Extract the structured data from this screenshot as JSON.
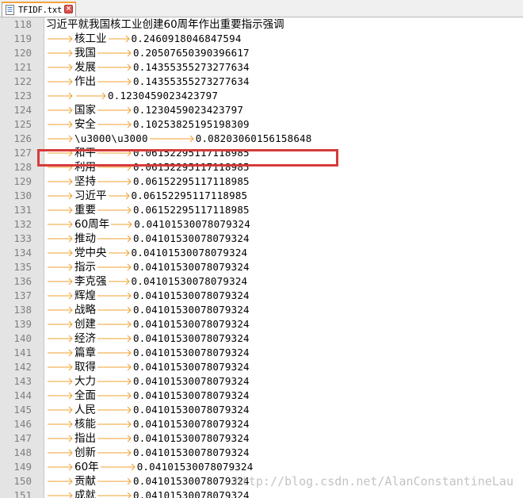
{
  "tab": {
    "label": "TFIDF.txt",
    "close_icon": "close-icon",
    "file_icon": "text-file-icon"
  },
  "colors": {
    "arrow": "#f0a030",
    "highlight": "#d63b3b",
    "gutter": "#e4e4e4"
  },
  "lines": [
    {
      "n": "118",
      "text": "习近平就我国核工业创建60周年作出重要指示强调",
      "value": "",
      "header": true
    },
    {
      "n": "119",
      "text": "核工业",
      "value": "0.2460918046847594"
    },
    {
      "n": "120",
      "text": "我国",
      "value": "0.20507650390396617"
    },
    {
      "n": "121",
      "text": "发展",
      "value": "0.14355355273277634"
    },
    {
      "n": "122",
      "text": "作出",
      "value": "0.14355355273277634"
    },
    {
      "n": "123",
      "text": "",
      "value": "0.1230459023423797",
      "emptyword": true
    },
    {
      "n": "124",
      "text": "国家",
      "value": "0.1230459023423797"
    },
    {
      "n": "125",
      "text": "安全",
      "value": "0.10253825195198309"
    },
    {
      "n": "126",
      "text": "\\u3000\\u3000",
      "value": "0.08203060156158648",
      "ascii": true
    },
    {
      "n": "127",
      "text": "和平",
      "value": "0.06152295117118985"
    },
    {
      "n": "128",
      "text": "利用",
      "value": "0.06152295117118985"
    },
    {
      "n": "129",
      "text": "坚持",
      "value": "0.06152295117118985"
    },
    {
      "n": "130",
      "text": "习近平",
      "value": "0.06152295117118985"
    },
    {
      "n": "131",
      "text": "重要",
      "value": "0.06152295117118985"
    },
    {
      "n": "132",
      "text": "60周年",
      "value": "0.04101530078079324"
    },
    {
      "n": "133",
      "text": "推动",
      "value": "0.04101530078079324"
    },
    {
      "n": "134",
      "text": "党中央",
      "value": "0.04101530078079324"
    },
    {
      "n": "135",
      "text": "指示",
      "value": "0.04101530078079324"
    },
    {
      "n": "136",
      "text": "李克强",
      "value": "0.04101530078079324"
    },
    {
      "n": "137",
      "text": "辉煌",
      "value": "0.04101530078079324"
    },
    {
      "n": "138",
      "text": "战略",
      "value": "0.04101530078079324"
    },
    {
      "n": "139",
      "text": "创建",
      "value": "0.04101530078079324"
    },
    {
      "n": "140",
      "text": "经济",
      "value": "0.04101530078079324"
    },
    {
      "n": "141",
      "text": "篇章",
      "value": "0.04101530078079324"
    },
    {
      "n": "142",
      "text": "取得",
      "value": "0.04101530078079324"
    },
    {
      "n": "143",
      "text": "大力",
      "value": "0.04101530078079324"
    },
    {
      "n": "144",
      "text": "全面",
      "value": "0.04101530078079324"
    },
    {
      "n": "145",
      "text": "人民",
      "value": "0.04101530078079324"
    },
    {
      "n": "146",
      "text": "核能",
      "value": "0.04101530078079324"
    },
    {
      "n": "147",
      "text": "指出",
      "value": "0.04101530078079324"
    },
    {
      "n": "148",
      "text": "创新",
      "value": "0.04101530078079324"
    },
    {
      "n": "149",
      "text": "60年",
      "value": "0.04101530078079324"
    },
    {
      "n": "150",
      "text": "贡献",
      "value": "0.04101530078079324"
    },
    {
      "n": "151",
      "text": "成就",
      "value": "0.04101530078079324"
    }
  ],
  "watermark": "http://blog.csdn.net/AlanConstantineLau"
}
